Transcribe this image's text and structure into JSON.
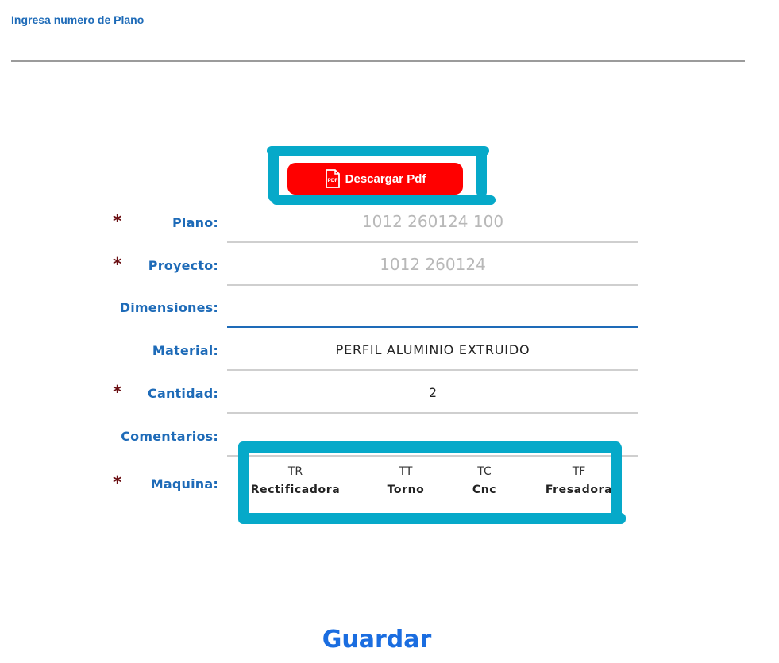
{
  "search": {
    "label": "Ingresa numero de Plano",
    "value": ""
  },
  "pdf_button": {
    "label": "Descargar Pdf",
    "icon_text": "PDF",
    "color": "#ff0000"
  },
  "form": {
    "plano": {
      "label": "Plano:",
      "placeholder": "1012 260124 100",
      "required": true
    },
    "proyecto": {
      "label": "Proyecto:",
      "placeholder": "1012 260124",
      "required": true
    },
    "dimensiones": {
      "label": "Dimensiones:",
      "value": "",
      "required": false
    },
    "material": {
      "label": "Material:",
      "value": "PERFIL ALUMINIO EXTRUIDO",
      "required": false
    },
    "cantidad": {
      "label": "Cantidad:",
      "value": "2",
      "required": true
    },
    "comentarios": {
      "label": "Comentarios:",
      "value": "",
      "required": false
    },
    "maquina": {
      "label": "Maquina:",
      "required": true
    },
    "required_mark": "*"
  },
  "machines": [
    {
      "code": "TR",
      "name": "Rectificadora"
    },
    {
      "code": "TT",
      "name": "Torno"
    },
    {
      "code": "TC",
      "name": "Cnc"
    },
    {
      "code": "TF",
      "name": "Fresadora"
    }
  ],
  "save_button": {
    "label": "Guardar"
  },
  "colors": {
    "accent": "#1e6bb8",
    "highlight": "#06a9c9",
    "required": "#6a0e12",
    "save": "#1a6de0"
  }
}
